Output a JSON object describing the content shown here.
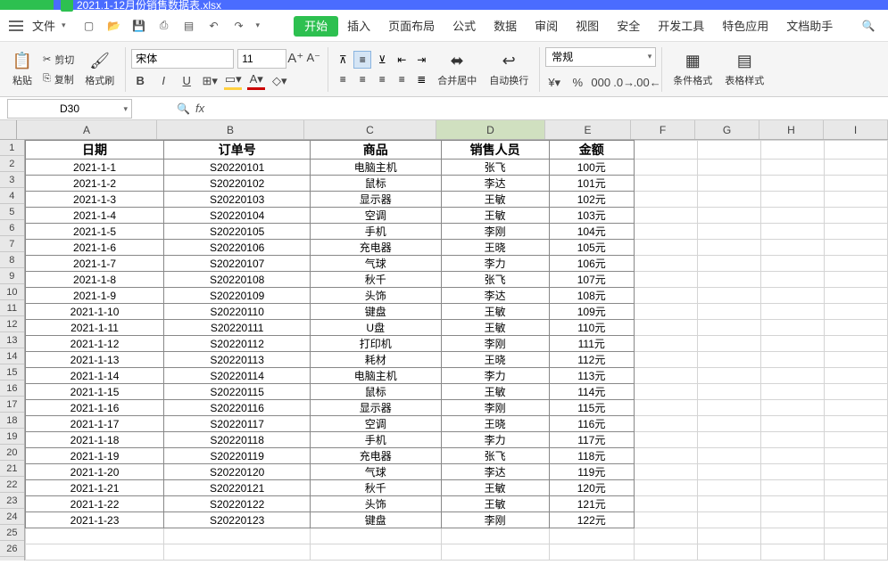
{
  "titlebar": {
    "filename": "2021.1-12月份销售数据表.xlsx"
  },
  "menu": {
    "file": "文件",
    "tabs": [
      "开始",
      "插入",
      "页面布局",
      "公式",
      "数据",
      "审阅",
      "视图",
      "安全",
      "开发工具",
      "特色应用",
      "文档助手"
    ]
  },
  "ribbon": {
    "paste": "粘贴",
    "cut": "剪切",
    "copy": "复制",
    "format_painter": "格式刷",
    "font_name": "宋体",
    "font_size": "11",
    "merge_center": "合并居中",
    "wrap_text": "自动换行",
    "number_format": "常规",
    "cond_format": "条件格式",
    "table_style": "表格样式"
  },
  "namebox": {
    "ref": "D30"
  },
  "columns": [
    "A",
    "B",
    "C",
    "D",
    "E",
    "F",
    "G",
    "H",
    "I"
  ],
  "header_row": [
    "日期",
    "订单号",
    "商品",
    "销售人员",
    "金额"
  ],
  "rows": [
    [
      "2021-1-1",
      "S20220101",
      "电脑主机",
      "张飞",
      "100元"
    ],
    [
      "2021-1-2",
      "S20220102",
      "鼠标",
      "李达",
      "101元"
    ],
    [
      "2021-1-3",
      "S20220103",
      "显示器",
      "王敏",
      "102元"
    ],
    [
      "2021-1-4",
      "S20220104",
      "空调",
      "王敏",
      "103元"
    ],
    [
      "2021-1-5",
      "S20220105",
      "手机",
      "李刚",
      "104元"
    ],
    [
      "2021-1-6",
      "S20220106",
      "充电器",
      "王晓",
      "105元"
    ],
    [
      "2021-1-7",
      "S20220107",
      "气球",
      "李力",
      "106元"
    ],
    [
      "2021-1-8",
      "S20220108",
      "秋千",
      "张飞",
      "107元"
    ],
    [
      "2021-1-9",
      "S20220109",
      "头饰",
      "李达",
      "108元"
    ],
    [
      "2021-1-10",
      "S20220110",
      "键盘",
      "王敏",
      "109元"
    ],
    [
      "2021-1-11",
      "S20220111",
      "U盘",
      "王敏",
      "110元"
    ],
    [
      "2021-1-12",
      "S20220112",
      "打印机",
      "李刚",
      "111元"
    ],
    [
      "2021-1-13",
      "S20220113",
      "耗材",
      "王晓",
      "112元"
    ],
    [
      "2021-1-14",
      "S20220114",
      "电脑主机",
      "李力",
      "113元"
    ],
    [
      "2021-1-15",
      "S20220115",
      "鼠标",
      "王敏",
      "114元"
    ],
    [
      "2021-1-16",
      "S20220116",
      "显示器",
      "李刚",
      "115元"
    ],
    [
      "2021-1-17",
      "S20220117",
      "空调",
      "王晓",
      "116元"
    ],
    [
      "2021-1-18",
      "S20220118",
      "手机",
      "李力",
      "117元"
    ],
    [
      "2021-1-19",
      "S20220119",
      "充电器",
      "张飞",
      "118元"
    ],
    [
      "2021-1-20",
      "S20220120",
      "气球",
      "李达",
      "119元"
    ],
    [
      "2021-1-21",
      "S20220121",
      "秋千",
      "王敏",
      "120元"
    ],
    [
      "2021-1-22",
      "S20220122",
      "头饰",
      "王敏",
      "121元"
    ],
    [
      "2021-1-23",
      "S20220123",
      "键盘",
      "李刚",
      "122元"
    ]
  ]
}
